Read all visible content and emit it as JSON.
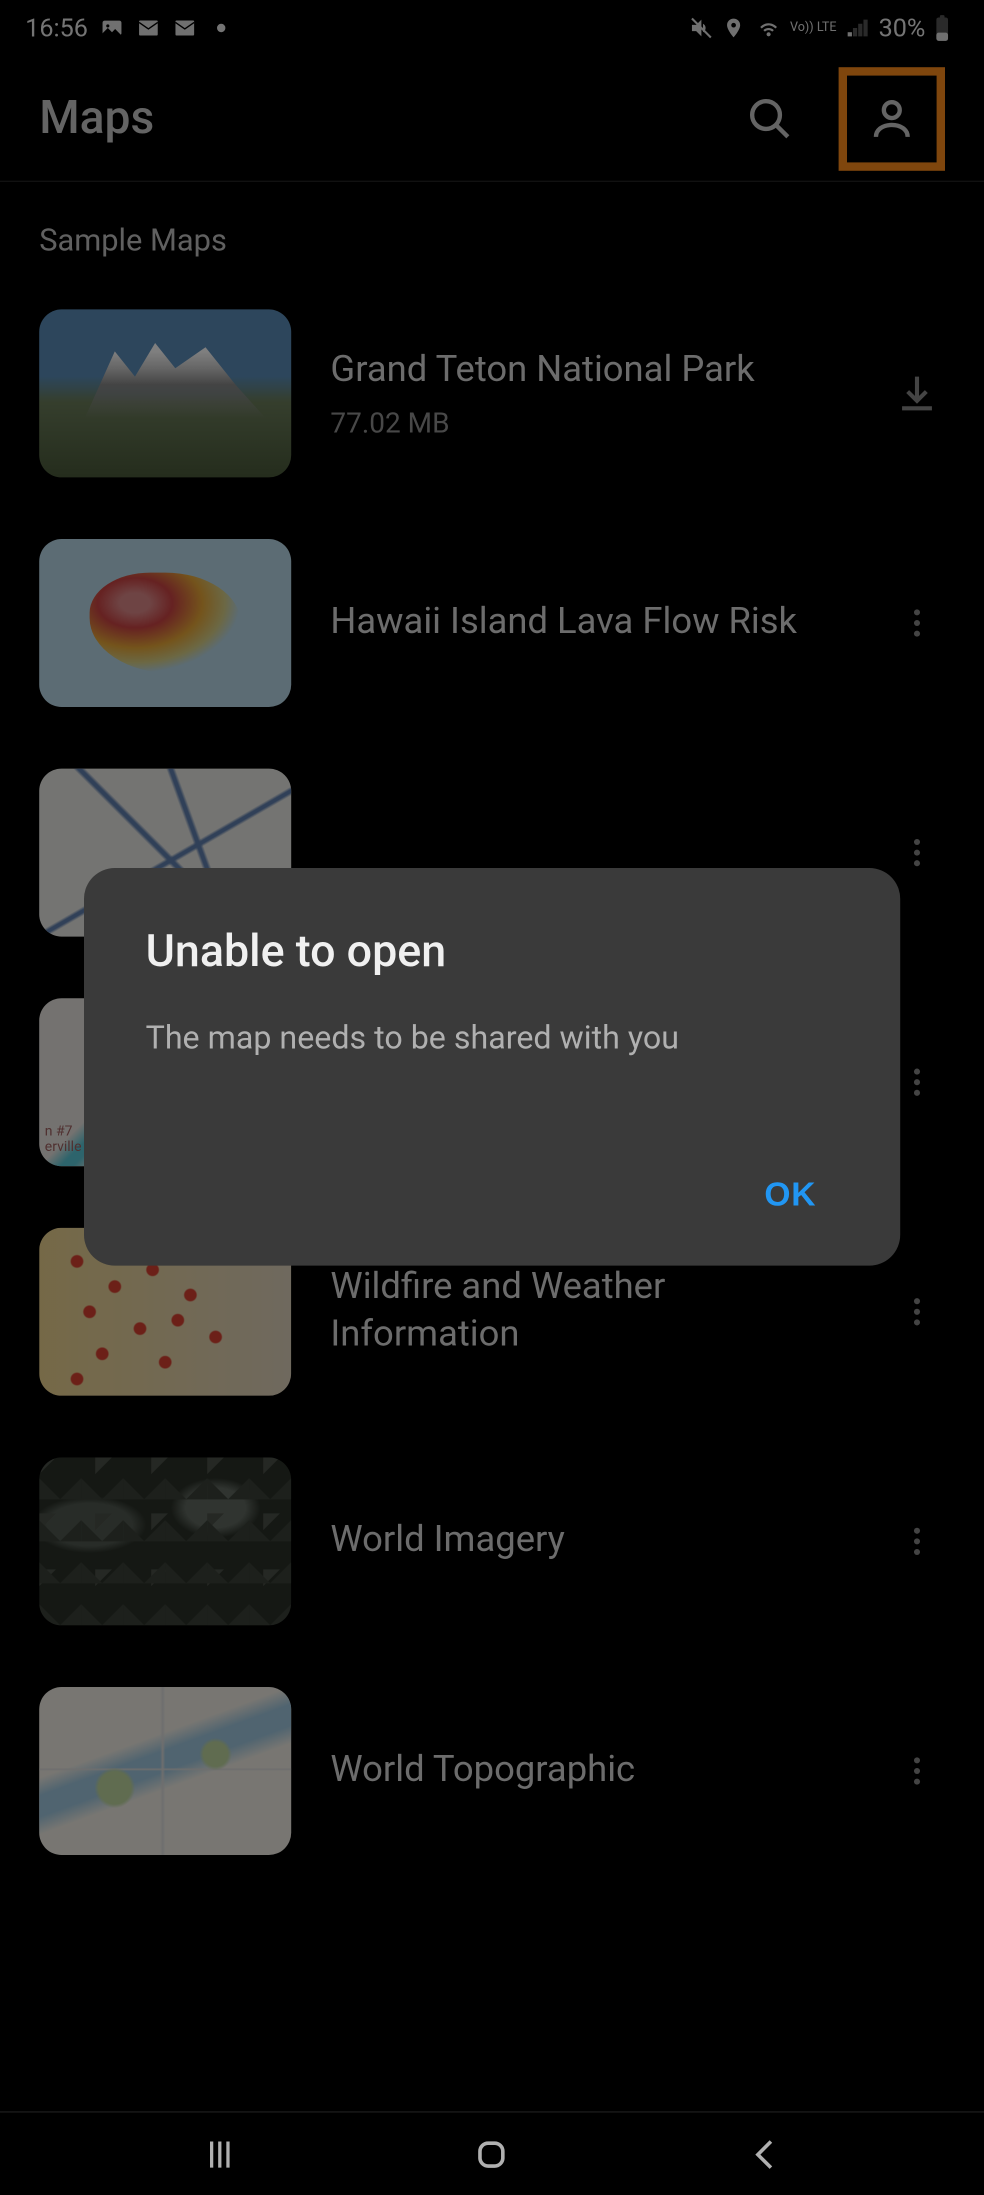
{
  "status_bar": {
    "time": "16:56",
    "battery_percent": "30%",
    "volte": "Vo)) LTE"
  },
  "app_bar": {
    "title": "Maps"
  },
  "section_title": "Sample Maps",
  "maps": [
    {
      "title": "Grand Teton National Park",
      "size": "77.02 MB",
      "action": "download"
    },
    {
      "title": "Hawaii Island Lava Flow Risk",
      "size": "",
      "action": "more"
    },
    {
      "title": "",
      "size": "",
      "action": "more"
    },
    {
      "title": "",
      "size": "",
      "action": "more"
    },
    {
      "title": "Wildfire and Weather Information",
      "size": "",
      "action": "more"
    },
    {
      "title": "World Imagery",
      "size": "",
      "action": "more"
    },
    {
      "title": "World Topographic",
      "size": "",
      "action": "more"
    }
  ],
  "dialog": {
    "title": "Unable to open",
    "message": "The map needs to be shared with you",
    "ok": "OK"
  }
}
